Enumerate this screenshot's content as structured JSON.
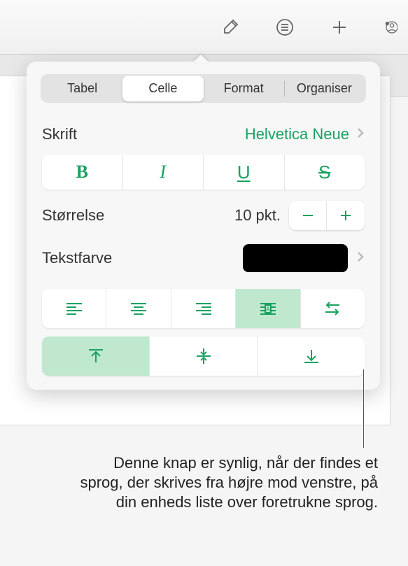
{
  "toolbar": {
    "icons": [
      "brush",
      "list",
      "plus",
      "collaborate"
    ]
  },
  "tabs": {
    "items": [
      "Tabel",
      "Celle",
      "Format",
      "Organiser"
    ],
    "active_index": 1
  },
  "font": {
    "label": "Skrift",
    "value": "Helvetica Neue"
  },
  "styles": {
    "bold": "B",
    "italic": "I",
    "underline": "U",
    "strike": "S"
  },
  "size": {
    "label": "Størrelse",
    "value": "10 pkt."
  },
  "text_color": {
    "label": "Tekstfarve",
    "color": "#000000"
  },
  "callout": "Denne knap er synlig, når der findes et sprog, der skrives fra højre mod venstre, på din enheds liste over foretrukne sprog."
}
